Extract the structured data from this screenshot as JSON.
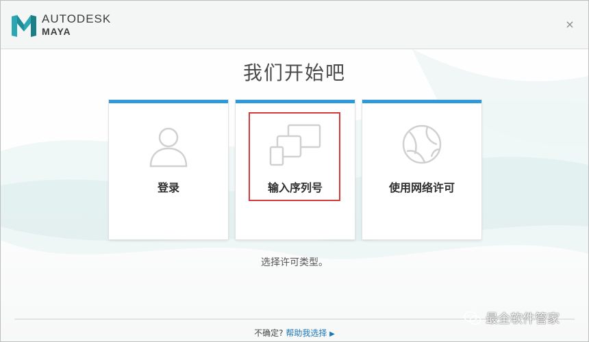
{
  "header": {
    "brand_line1": "AUTODESK",
    "brand_line2": "MAYA",
    "close_glyph": "×",
    "logo_icon": "maya-m-icon"
  },
  "main": {
    "title": "我们开始吧",
    "subtitle": "选择许可类型。",
    "accent_color": "#2b9ad9",
    "highlight_color": "#d23a3a",
    "options": [
      {
        "label": "登录",
        "icon": "user-silhouette-icon"
      },
      {
        "label": "输入序列号",
        "icon": "devices-icon"
      },
      {
        "label": "使用网络许可",
        "icon": "network-globe-icon"
      }
    ],
    "selected_option": "输入序列号"
  },
  "footer": {
    "prompt": "不确定?",
    "help_link": "帮助我选择",
    "help_arrow": "▶"
  },
  "watermark": {
    "text": "最全软件管家",
    "icon": "wechat-icon"
  }
}
